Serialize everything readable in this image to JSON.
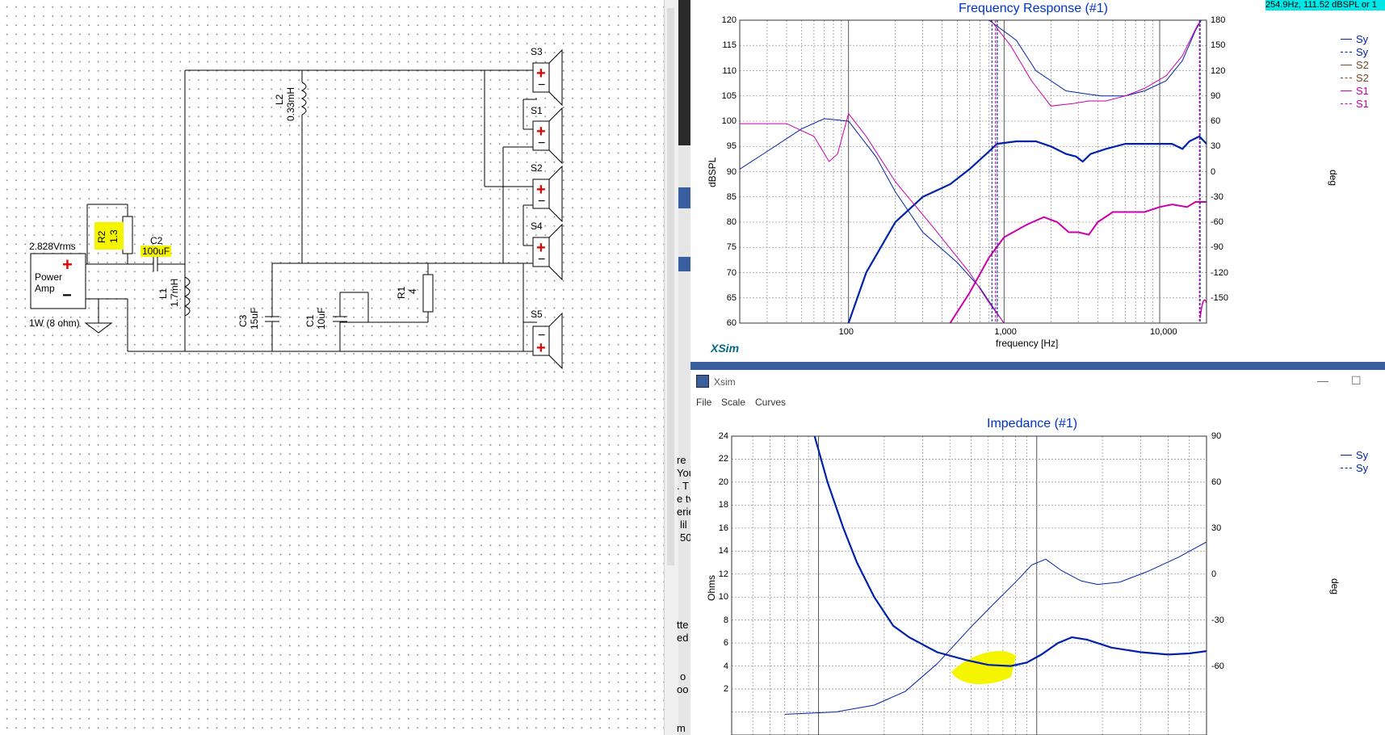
{
  "schematic": {
    "source_value": "2.828Vrms",
    "amp_label": "Power Amp",
    "amp_rating": "1W (8 ohm)",
    "components": {
      "r2_name": "R2",
      "r2_value": "1.3",
      "c2_name": "C2",
      "c2_value": "100uF",
      "l1_name": "L1",
      "l1_value": "1.7mH",
      "l2_name": "L2",
      "l2_value": "0.33mH",
      "c3_name": "C3",
      "c3_value": "15uF",
      "c1_name": "C1",
      "c1_value": "10uF",
      "r1_name": "R1",
      "r1_value": "4"
    },
    "speakers": [
      "S3",
      "S1",
      "S2",
      "S4",
      "S5"
    ],
    "plus_sign": "+",
    "minus_sign": "−"
  },
  "frequency_chart": {
    "title": "Frequency Response (#1)",
    "readout": "254.9Hz, 111.52 dBSPL or 1",
    "ylabel_left": "dBSPL",
    "ylabel_right": "deg",
    "xlabel": "frequency [Hz]",
    "brand": "XSim",
    "y_ticks_left": [
      "120",
      "115",
      "110",
      "105",
      "100",
      "95",
      "90",
      "85",
      "80",
      "75",
      "70",
      "65",
      "60"
    ],
    "y_ticks_right": [
      "180",
      "150",
      "120",
      "90",
      "60",
      "30",
      "0",
      "-30",
      "-60",
      "-90",
      "-120",
      "-150"
    ],
    "x_ticks": [
      "100",
      "1,000",
      "10,000"
    ],
    "legend": [
      {
        "label": "Sy",
        "color": "#0022aa",
        "style": "solid"
      },
      {
        "label": "Sy",
        "color": "#0022aa",
        "style": "dashed"
      },
      {
        "label": "S2",
        "color": "#7a4a2a",
        "style": "solid"
      },
      {
        "label": "S2",
        "color": "#7a4a2a",
        "style": "dashed"
      },
      {
        "label": "S1",
        "color": "#cc00aa",
        "style": "solid"
      },
      {
        "label": "S1",
        "color": "#cc00aa",
        "style": "dashed"
      }
    ]
  },
  "impedance_window": {
    "window_title": "Xsim",
    "menu": [
      "File",
      "Scale",
      "Curves"
    ],
    "minimize": "—",
    "maximize": "☐",
    "title": "Impedance (#1)",
    "ylabel_left": "Ohms",
    "ylabel_right": "deg",
    "y_ticks_left": [
      "24",
      "22",
      "20",
      "18",
      "16",
      "14",
      "12",
      "10",
      "8",
      "6",
      "4",
      "2"
    ],
    "y_ticks_right": [
      "90",
      "60",
      "30",
      "0",
      "-30",
      "-60"
    ],
    "legend": [
      {
        "label": "Sy",
        "color": "#0022aa",
        "style": "solid"
      },
      {
        "label": "Sy",
        "color": "#0022aa",
        "style": "dashed"
      }
    ]
  },
  "left_panel_fragments": [
    "re",
    "You",
    ". T",
    "e tv",
    "erie",
    "lil",
    "50",
    "tte",
    "ed",
    "o",
    "oo",
    "m"
  ],
  "colors": {
    "accent_blue": "#0022aa",
    "magenta": "#cc00aa",
    "title_blue": "#0033cc",
    "highlight": "#f5f500"
  }
}
